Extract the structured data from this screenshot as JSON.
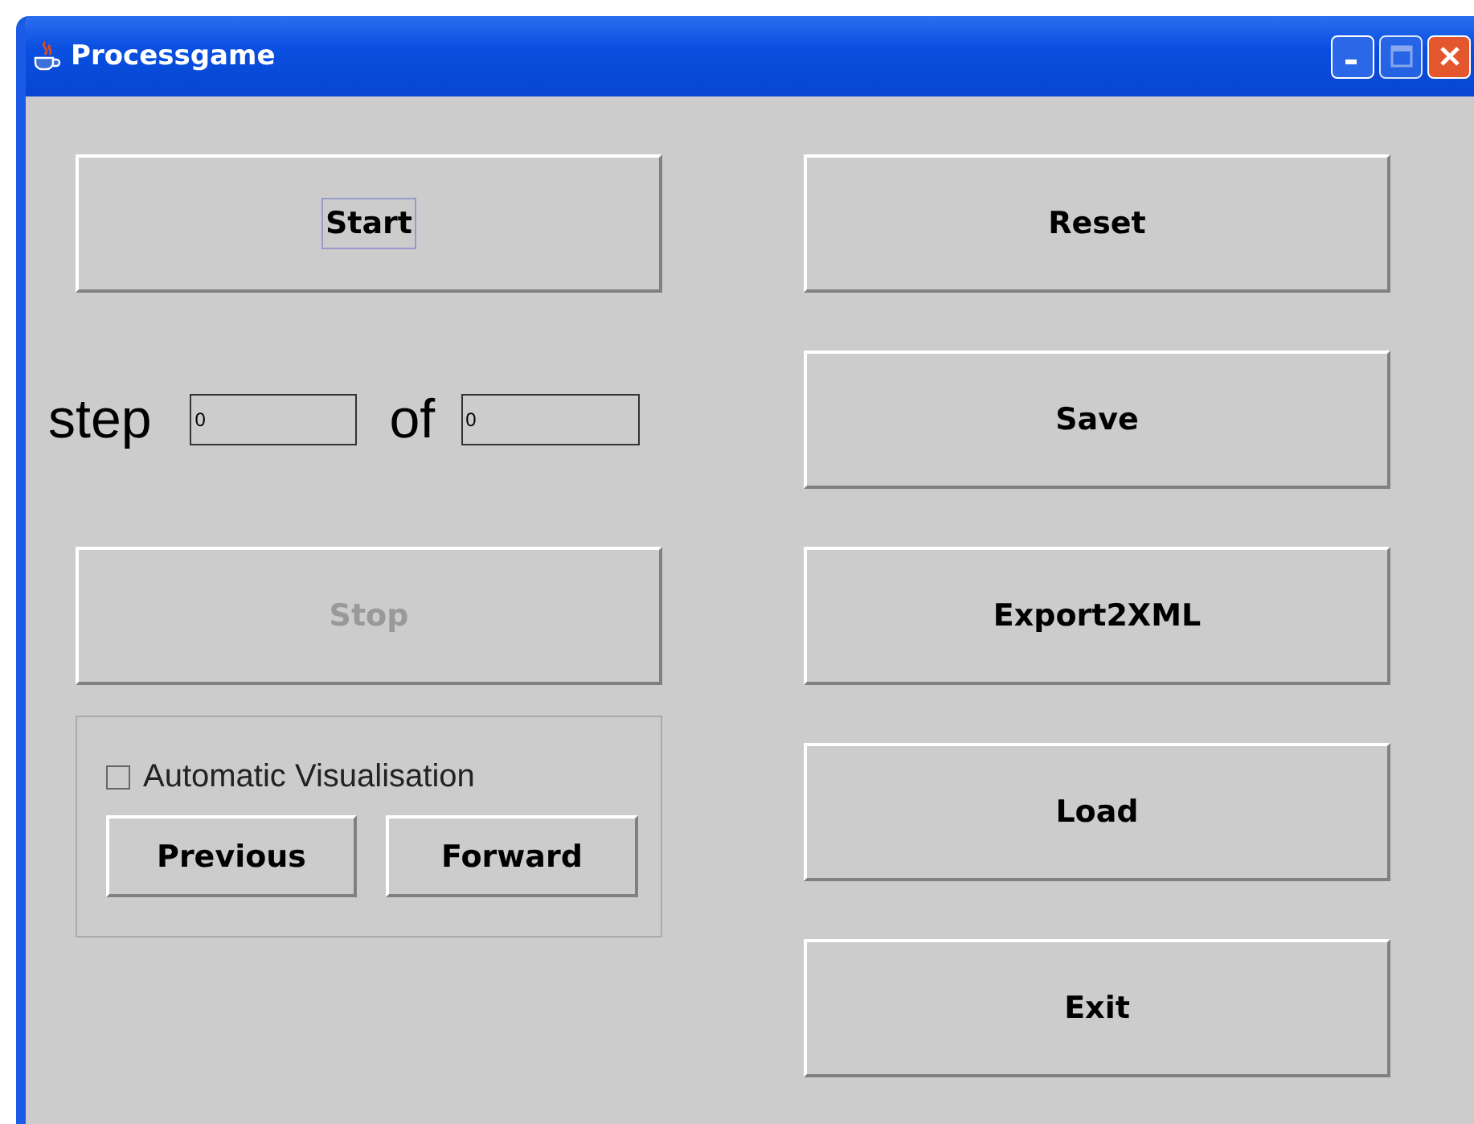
{
  "window": {
    "title": "Processgame"
  },
  "start_button": {
    "label": "Start",
    "focused": true,
    "disabled": false
  },
  "step": {
    "label": "step",
    "value": "0",
    "of_label": "of",
    "total": "0"
  },
  "stop_button": {
    "label": "Stop",
    "focused": false,
    "disabled": true
  },
  "visualisation": {
    "checkbox": {
      "label": "Automatic Visualisation",
      "checked": false
    },
    "buttons": [
      {
        "label": "Previous",
        "disabled": false
      },
      {
        "label": "Forward",
        "disabled": false
      }
    ]
  },
  "right_buttons": [
    {
      "label": "Reset",
      "disabled": false
    },
    {
      "label": "Save",
      "disabled": false
    },
    {
      "label": "Export2XML",
      "disabled": false
    },
    {
      "label": "Load",
      "disabled": false
    },
    {
      "label": "Exit",
      "disabled": false
    }
  ]
}
